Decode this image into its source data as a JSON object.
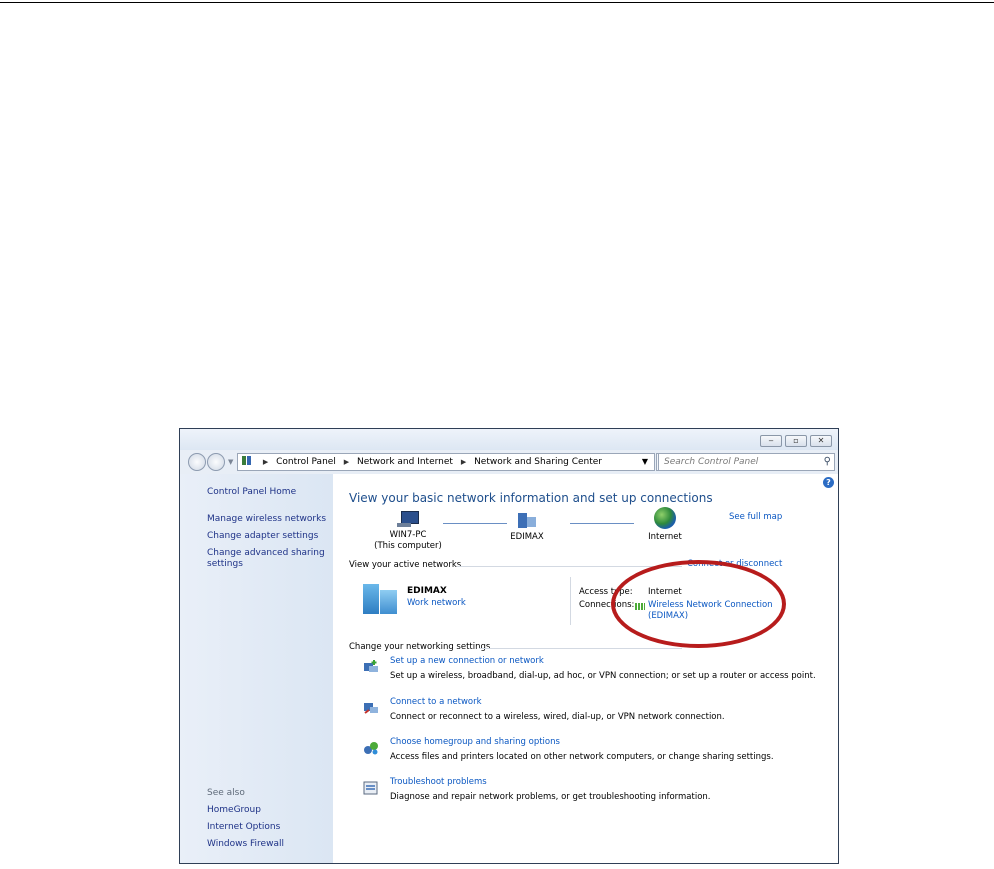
{
  "window": {
    "address": {
      "crumbs": [
        "Control Panel",
        "Network and Internet",
        "Network and Sharing Center"
      ]
    },
    "search": {
      "placeholder": "Search Control Panel"
    },
    "sidebar": {
      "home": "Control Panel Home",
      "links": [
        "Manage wireless networks",
        "Change adapter settings",
        "Change advanced sharing",
        "settings"
      ],
      "see_also_label": "See also",
      "see_also": [
        "HomeGroup",
        "Internet Options",
        "Windows Firewall"
      ]
    },
    "main": {
      "title": "View your basic network information and set up connections",
      "see_full_map": "See full map",
      "map": {
        "computer_name": "WIN7-PC",
        "computer_note": "(This computer)",
        "network_name": "EDIMAX",
        "internet_label": "Internet"
      },
      "active_networks": {
        "heading": "View your active networks",
        "connect_link": "Connect or disconnect",
        "network_name": "EDIMAX",
        "network_type": "Work network",
        "access_type_label": "Access type:",
        "access_type_value": "Internet",
        "connections_label": "Connections:",
        "connection_line1": "Wireless Network Connection",
        "connection_line2": "(EDIMAX)"
      },
      "change_settings": {
        "heading": "Change your networking settings",
        "tasks": [
          {
            "link": "Set up a new connection or network",
            "desc": "Set up a wireless, broadband, dial-up, ad hoc, or VPN connection; or set up a router or access point.",
            "icon": "new-connection-icon"
          },
          {
            "link": "Connect to a network",
            "desc": "Connect or reconnect to a wireless, wired, dial-up, or VPN network connection.",
            "icon": "connect-network-icon"
          },
          {
            "link": "Choose homegroup and sharing options",
            "desc": "Access files and printers located on other network computers, or change sharing settings.",
            "icon": "homegroup-icon"
          },
          {
            "link": "Troubleshoot problems",
            "desc": "Diagnose and repair network problems, or get troubleshooting information.",
            "icon": "troubleshoot-icon"
          }
        ]
      }
    }
  },
  "colors": {
    "link": "#0a57c2",
    "title": "#1e4e8c",
    "annotation": "#b71c1c"
  }
}
